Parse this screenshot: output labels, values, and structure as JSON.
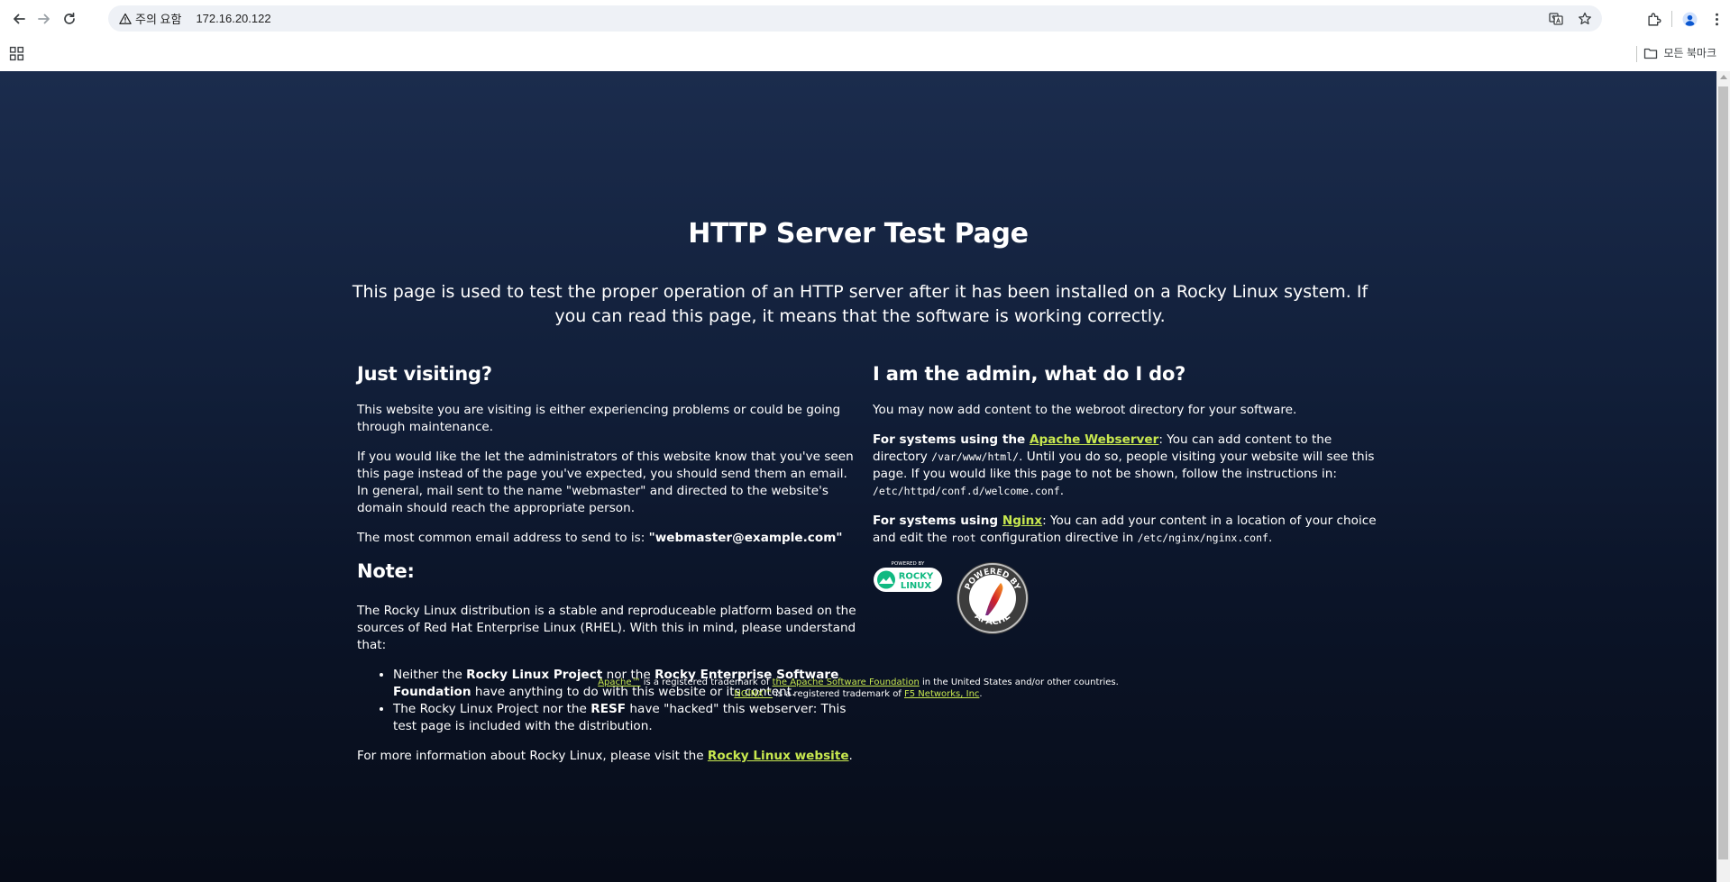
{
  "browser": {
    "security_label": "주의 요함",
    "url": "172.16.20.122",
    "all_bookmarks_label": "모든 북마크"
  },
  "page": {
    "title": "HTTP Server Test Page",
    "lead": "This page is used to test the proper operation of an HTTP server after it has been installed on a Rocky Linux system. If you can read this page, it means that the software is working correctly.",
    "left": {
      "heading": "Just visiting?",
      "p1": "This website you are visiting is either experiencing problems or could be going through maintenance.",
      "p2": "If you would like the let the administrators of this website know that you've seen this page instead of the page you've expected, you should send them an email. In general, mail sent to the name \"webmaster\" and directed to the website's domain should reach the appropriate person.",
      "p3_prefix": "The most common email address to send to is: ",
      "p3_email": "\"webmaster@example.com\"",
      "note_heading": "Note:",
      "note_p": "The Rocky Linux distribution is a stable and reproduceable platform based on the sources of Red Hat Enterprise Linux (RHEL). With this in mind, please understand that:",
      "bullet1": {
        "t1": "Neither the ",
        "b1": "Rocky Linux Project",
        "t2": " nor the ",
        "b2": "Rocky Enterprise Software Foundation",
        "t3": " have anything to do with this website or its content."
      },
      "bullet2": {
        "t1": "The Rocky Linux Project nor the ",
        "b1": "RESF",
        "t2": " have \"hacked\" this webserver: This test page is included with the distribution."
      },
      "more_prefix": "For more information about Rocky Linux, please visit the ",
      "more_link": "Rocky Linux website",
      "more_suffix": "."
    },
    "right": {
      "heading": "I am the admin, what do I do?",
      "p1": "You may now add content to the webroot directory for your software.",
      "apache_prefix": "For systems using the ",
      "apache_link": "Apache Webserver",
      "apache_t1": ": You can add content to the directory ",
      "apache_dir": "/var/www/html/",
      "apache_t2": ". Until you do so, people visiting your website will see this page. If you would like this page to not be shown, follow the instructions in: ",
      "apache_conf": "/etc/httpd/conf.d/welcome.conf",
      "apache_t3": ".",
      "nginx_prefix": "For systems using ",
      "nginx_link": "Nginx",
      "nginx_t1": ": You can add your content in a location of your choice and edit the ",
      "nginx_root": "root",
      "nginx_t2": " configuration directive in ",
      "nginx_conf": "/etc/nginx/nginx.conf",
      "nginx_t3": ".",
      "rocky_logo": {
        "top": "POWERED BY",
        "line1": "ROCKY",
        "line2": "LINUX"
      },
      "apache_logo": {
        "top": "POWERED BY",
        "bottom": "APACHE"
      }
    },
    "footer": {
      "l1_link1": "Apache™",
      "l1_t1": " is a registered trademark of ",
      "l1_link2": "the Apache Software Foundation",
      "l1_t2": " in the United States and/or other countries.",
      "l2_link1": "NGINX™",
      "l2_t1": " is a registered trademark of ",
      "l2_link2": "F5 Networks, Inc",
      "l2_t2": "."
    }
  },
  "colors": {
    "link": "#c8e84f",
    "bg_top": "#1b2c4d",
    "bg_bottom": "#070c18",
    "rocky_green": "#10b981"
  }
}
